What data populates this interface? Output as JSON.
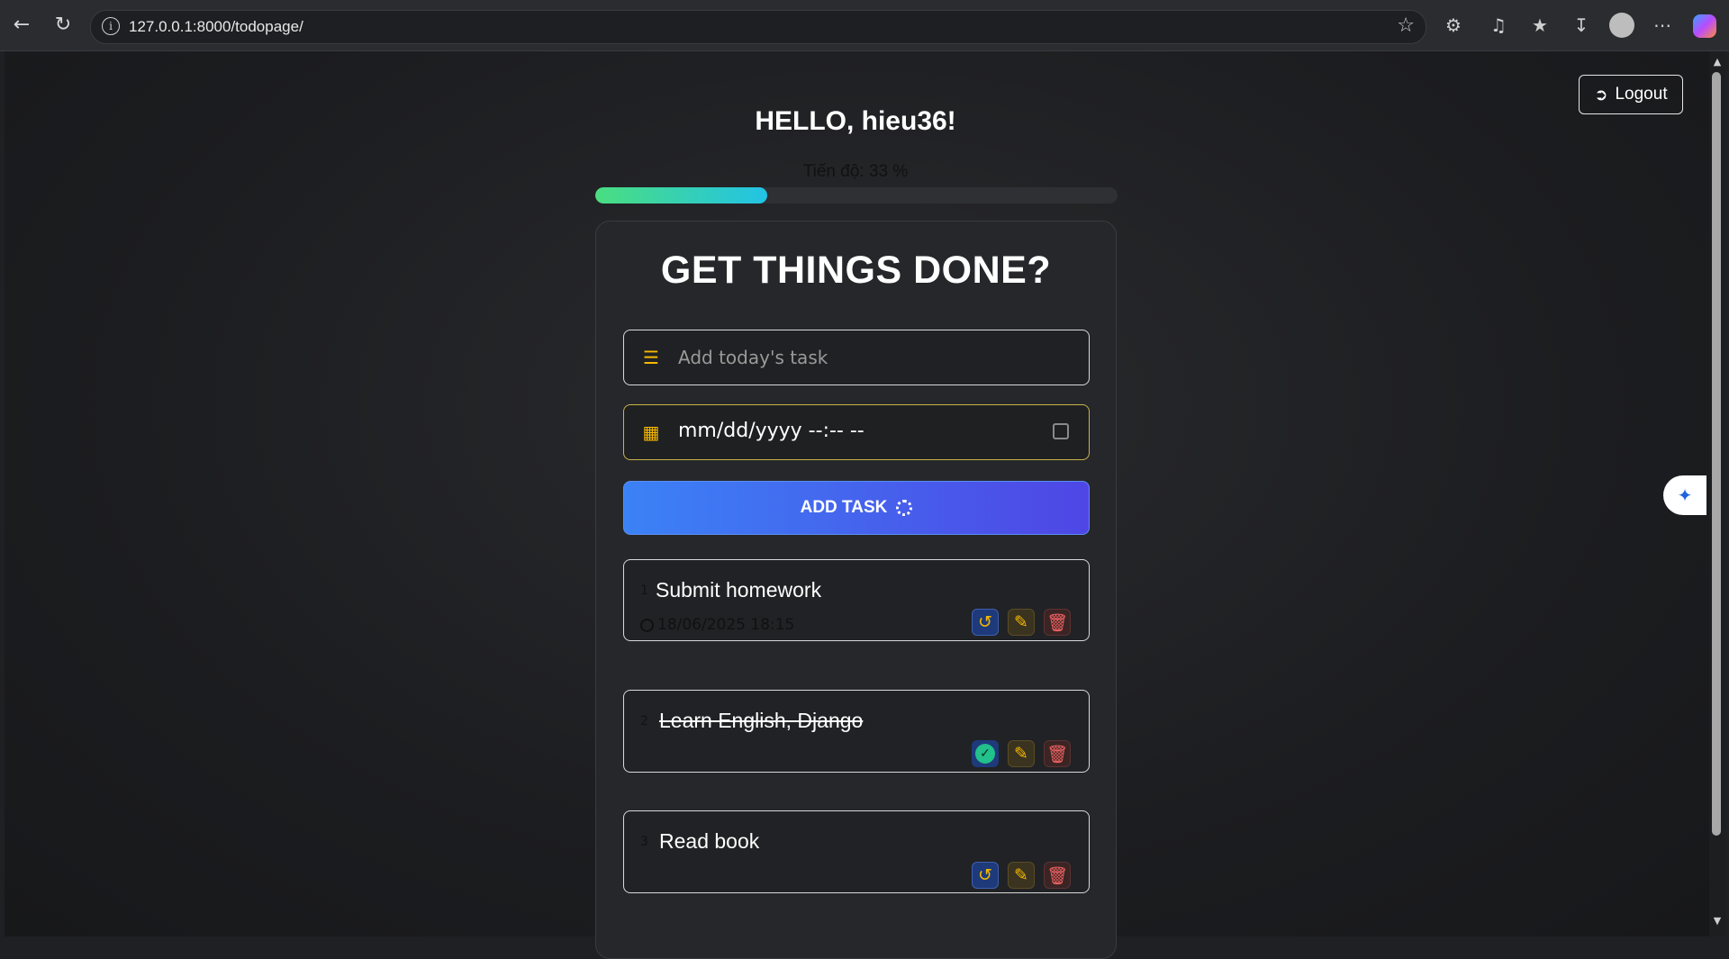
{
  "browser": {
    "url": "127.0.0.1:8000/todopage/"
  },
  "header": {
    "logout_label": "Logout",
    "greeting": "HELLO, hieu36!"
  },
  "progress": {
    "label": "Tiến độ: 33 %",
    "value": 0.33
  },
  "form": {
    "title": "GET THINGS DONE?",
    "task_placeholder": "Add today's task",
    "datetime_placeholder": "mm/dd/yyyy --:-- --",
    "add_label": "ADD TASK"
  },
  "tasks": [
    {
      "num": "1",
      "name": "Submit homework",
      "due": "18/06/2025 18:15",
      "completed": false
    },
    {
      "num": "2",
      "name": "Learn English, Django",
      "due": "",
      "completed": true
    },
    {
      "num": "3",
      "name": "Read book",
      "due": "",
      "completed": false
    }
  ],
  "colors": {
    "accent_yellow": "#f5b800",
    "button_gradient_start": "#3b82f6",
    "button_gradient_end": "#4f46e5",
    "progress_start": "#4ade80",
    "progress_end": "#22c3e6",
    "delete_red": "#f06262",
    "done_green": "#22c08a"
  },
  "icons": {
    "task_field": "list-check-icon",
    "date_field": "calendar-icon",
    "logout": "sign-out-icon",
    "undo": "undo-icon",
    "complete": "check-circle-icon",
    "edit": "edit-icon",
    "delete": "trash-icon"
  }
}
